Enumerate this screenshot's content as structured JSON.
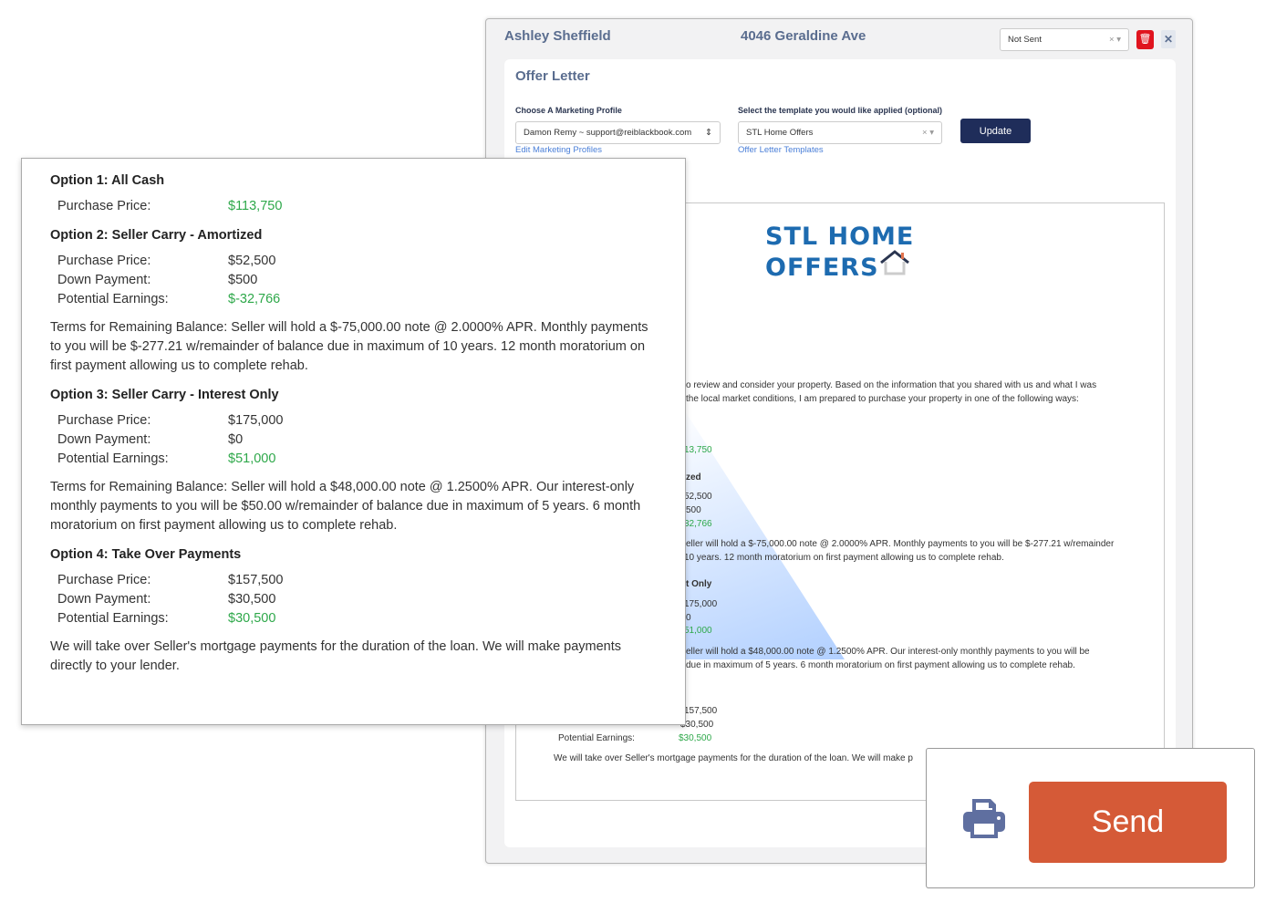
{
  "header": {
    "contact_name": "Ashley Sheffield",
    "address": "4046 Geraldine Ave",
    "status_value": "Not Sent"
  },
  "offer_letter": {
    "title": "Offer Letter",
    "profile_label": "Choose A Marketing Profile",
    "profile_value": "Damon Remy ~ support@reiblackbook.com",
    "profile_link": "Edit Marketing Profiles",
    "template_label": "Select the template you would like applied (optional)",
    "template_value": "STL Home Offers",
    "template_link": "Offer Letter Templates",
    "update_label": "Update"
  },
  "logo": {
    "line1": "STL HOME",
    "line2": "OFFERS"
  },
  "letter_fragments": [
    "o review and consider your property. Based on the information that you shared with us and what I was",
    "the local market conditions, I am prepared to purchase your property in one of the following ways:",
    "13,750",
    "zed",
    "52,500",
    "500",
    "32,766",
    "eller will hold a $-75,000.00 note @ 2.0000% APR. Monthly payments to you will be $-277.21 w/remainder",
    "10 years. 12 month moratorium on first payment allowing us to complete rehab.",
    "t Only",
    "175,000",
    "0",
    "51,000",
    "eller will hold a $48,000.00 note @ 1.2500% APR. Our interest-only monthly payments to you will be",
    "due in maximum of 5 years. 6 month moratorium on first payment allowing us to complete rehab.",
    "157,500",
    "$30,500",
    "Potential Earnings:",
    "$30,500",
    "We will take over Seller's mortgage payments for the duration of the loan. We will make p"
  ],
  "options": [
    {
      "title": "Option 1: All Cash",
      "rows": [
        {
          "k": "Purchase Price:",
          "v": "$113,750",
          "green": true
        }
      ]
    },
    {
      "title": "Option 2: Seller Carry - Amortized",
      "rows": [
        {
          "k": "Purchase Price:",
          "v": "$52,500"
        },
        {
          "k": "Down Payment:",
          "v": "$500"
        },
        {
          "k": "Potential Earnings:",
          "v": "$-32,766",
          "green": true
        }
      ],
      "terms": "Terms for Remaining Balance: Seller will hold a $-75,000.00 note @ 2.0000% APR. Monthly payments to you will be $-277.21 w/remainder of balance due in maximum of 10 years. 12 month moratorium on first payment allowing us to complete rehab."
    },
    {
      "title": "Option 3: Seller Carry - Interest Only",
      "rows": [
        {
          "k": "Purchase Price:",
          "v": "$175,000"
        },
        {
          "k": "Down Payment:",
          "v": "$0"
        },
        {
          "k": "Potential Earnings:",
          "v": "$51,000",
          "green": true
        }
      ],
      "terms": "Terms for Remaining Balance: Seller will hold a $48,000.00 note @ 1.2500% APR. Our interest-only monthly payments to you will be $50.00 w/remainder of balance due in maximum of 5 years. 6 month moratorium on first payment allowing us to complete rehab."
    },
    {
      "title": "Option 4: Take Over Payments",
      "rows": [
        {
          "k": "Purchase Price:",
          "v": "$157,500"
        },
        {
          "k": "Down Payment:",
          "v": "$30,500"
        },
        {
          "k": "Potential Earnings:",
          "v": "$30,500",
          "green": true
        }
      ],
      "terms": "We will take over Seller's mortgage payments for the duration of the loan. We will make payments directly to your lender."
    }
  ],
  "actions": {
    "send_label": "Send",
    "print_icon": "printer-icon"
  },
  "colors": {
    "send": "#d55a37",
    "update": "#1f2d5a",
    "delete": "#e0141e",
    "green": "#2ea84a",
    "logo": "#1d6bb0"
  }
}
